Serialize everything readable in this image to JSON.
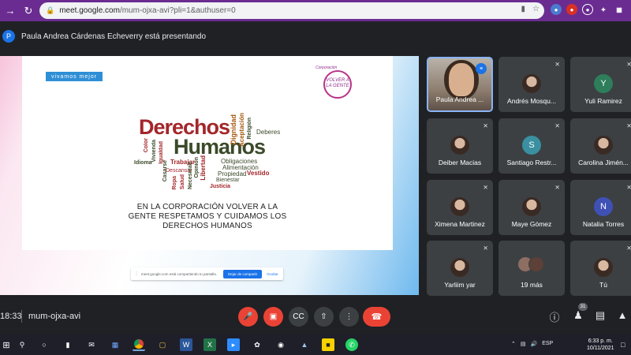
{
  "browser": {
    "url_host": "meet.google.com",
    "url_path": "/mum-ojxa-avi?pli=1&authuser=0",
    "extensions": [
      {
        "name": "camera-icon",
        "color": "#5f6368"
      },
      {
        "name": "star-icon",
        "color": "#5f6368"
      }
    ]
  },
  "presenting": {
    "avatar_letter": "P",
    "text": "Paula Andrea Cárdenas Echeverry está presentando"
  },
  "slide": {
    "logo_left": "vivamos mejor",
    "logo_right_label": "Corporación",
    "logo_right": "VOLVER A LA GENTE",
    "cloud": {
      "derechos": "Derechos",
      "humanos": "Humanos",
      "dignidad": "Dignidad",
      "aceptacion": "Aceptación",
      "religion": "Religión",
      "deberes": "Deberes",
      "color": "Color",
      "vivienda": "Vivienda",
      "igualdad": "Igualdad",
      "idioma": "Idioma",
      "trabajar": "Trabajar",
      "obligaciones": "Obligaciones",
      "alimentacion": "Alimentación",
      "propiedad": "Propiedad",
      "vestido": "Vestido",
      "descansar": "Descansar",
      "bienestar": "Bienestar",
      "justicia": "Justicia",
      "casarse": "Casarse",
      "libertad": "Libertad",
      "opinion": "Opinión",
      "necesidad": "Necesidad",
      "salud": "Salud",
      "ropa": "Ropa"
    },
    "line1": "EN LA CORPORACIÓN VOLVER A LA",
    "line2": "GENTE RESPETAMOS Y CUIDAMOS LOS",
    "line3": "DERECHOS HUMANOS"
  },
  "sharebar": {
    "message": "meet.google.com está compartiendo tu pantalla.",
    "stop_label": "Dejar de compartir",
    "hide_label": "Ocultar"
  },
  "participants": [
    {
      "name": "Paula Andrea ...",
      "type": "camera",
      "speaking": true
    },
    {
      "name": "Andrés Mosqu...",
      "type": "photo",
      "muted": true
    },
    {
      "name": "Yuli Ramirez",
      "type": "letter",
      "letter": "Y",
      "color": "#2e7d5b",
      "muted": true
    },
    {
      "name": "Deiber Macias",
      "type": "photo",
      "muted": true
    },
    {
      "name": "Santiago Restr...",
      "type": "letter",
      "letter": "S",
      "color": "#3a8fa0",
      "muted": true
    },
    {
      "name": "Carolina Jimén...",
      "type": "photo",
      "muted": true
    },
    {
      "name": "Ximena Martinez",
      "type": "photo",
      "muted": true
    },
    {
      "name": "Maye Gómez",
      "type": "photo",
      "muted": true
    },
    {
      "name": "Natalia Torres",
      "type": "letter",
      "letter": "N",
      "color": "#3f51b5",
      "muted": true
    },
    {
      "name": "Yarliim yar",
      "type": "photo",
      "muted": true
    },
    {
      "name": "19 más",
      "type": "stack"
    },
    {
      "name": "Tú",
      "type": "photo",
      "muted": true
    }
  ],
  "meetbar": {
    "time": "18:33",
    "code": "mum-ojxa-avi",
    "people_count": "31"
  },
  "taskbar": {
    "language": "ESP",
    "time": "6:33 p. m.",
    "date": "10/11/2021"
  }
}
